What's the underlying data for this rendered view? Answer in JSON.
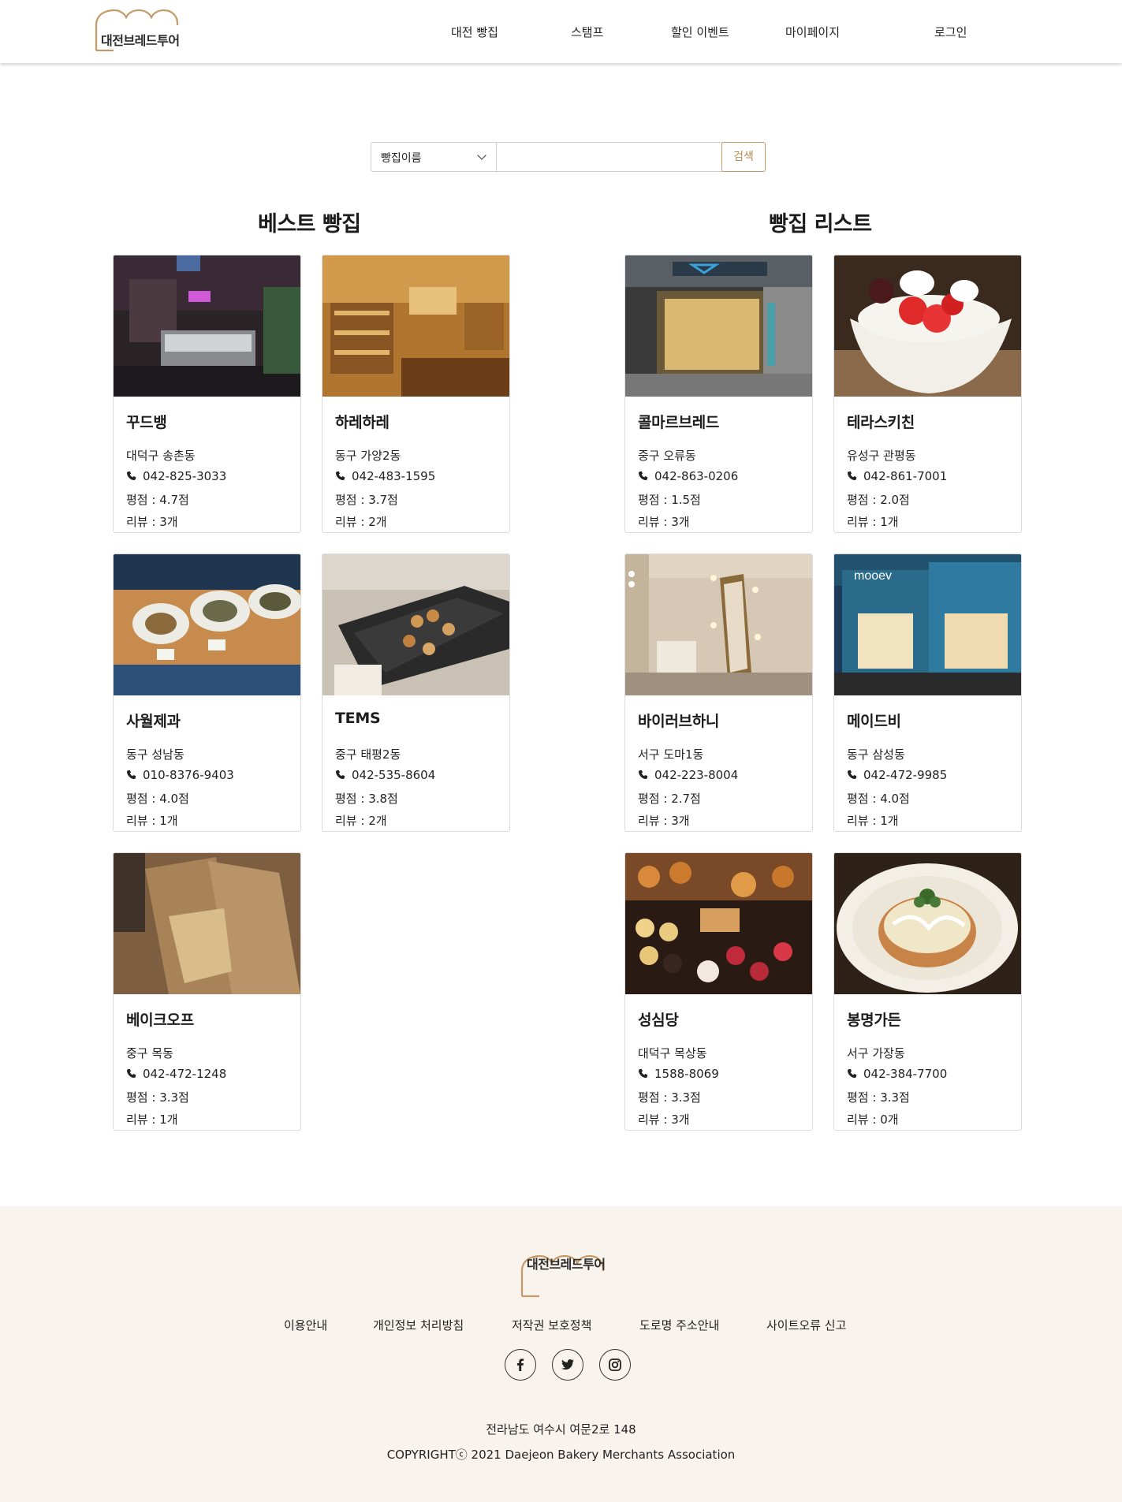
{
  "brand": {
    "name": "대전브레드투어"
  },
  "colors": {
    "accent": "#c79a65",
    "footer_bg": "#f8f4ed"
  },
  "nav": {
    "items": [
      "대전 빵집",
      "스탬프",
      "할인 이벤트",
      "마이페이지"
    ],
    "login": "로그인"
  },
  "search": {
    "select_value": "빵집이름",
    "input_value": "",
    "button": "검색"
  },
  "sections": {
    "best": "베스트 빵집",
    "list": "빵집 리스트"
  },
  "best_bakeries": [
    {
      "name": "꾸드뱅",
      "address": "대덕구 송촌동",
      "phone": "042-825-3033",
      "rating": "평점 : 4.7점",
      "reviews": "리뷰 : 3개",
      "photo": "cafe-interior-night"
    },
    {
      "name": "하레하레",
      "address": "동구 가양2동",
      "phone": "042-483-1595",
      "rating": "평점 : 3.7점",
      "reviews": "리뷰 : 2개",
      "photo": "wooden-shop-interior"
    },
    {
      "name": "사월제과",
      "address": "동구 성남동",
      "phone": "010-8376-9403",
      "rating": "평점 : 4.0점",
      "reviews": "리뷰 : 1개",
      "photo": "plates-on-table"
    },
    {
      "name": "TEMS",
      "address": "중구 태평2동",
      "phone": "042-535-8604",
      "rating": "평점 : 3.8점",
      "reviews": "리뷰 : 2개",
      "photo": "bread-trays"
    },
    {
      "name": "베이크오프",
      "address": "중구 목동",
      "phone": "042-472-1248",
      "rating": "평점 : 3.3점",
      "reviews": "리뷰 : 1개",
      "photo": "paper-bags"
    }
  ],
  "bakery_list": [
    {
      "name": "콜마르브레드",
      "address": "중구 오류동",
      "phone": "042-863-0206",
      "rating": "평점 : 1.5점",
      "reviews": "리뷰 : 3개",
      "photo": "storefront"
    },
    {
      "name": "테라스키친",
      "address": "유성구 관평동",
      "phone": "042-861-7001",
      "rating": "평점 : 2.0점",
      "reviews": "리뷰 : 1개",
      "photo": "strawberry-bingsu"
    },
    {
      "name": "바이러브하니",
      "address": "서구 도마1동",
      "phone": "042-223-8004",
      "rating": "평점 : 2.7점",
      "reviews": "리뷰 : 3개",
      "photo": "mirror-interior"
    },
    {
      "name": "메이드비",
      "address": "동구 삼성동",
      "phone": "042-472-9985",
      "rating": "평점 : 4.0점",
      "reviews": "리뷰 : 1개",
      "photo": "blue-storefront"
    },
    {
      "name": "성심당",
      "address": "대덕구 목상동",
      "phone": "1588-8069",
      "rating": "평점 : 3.3점",
      "reviews": "리뷰 : 3개",
      "photo": "pastry-display"
    },
    {
      "name": "봉명가든",
      "address": "서구 가장동",
      "phone": "042-384-7700",
      "rating": "평점 : 3.3점",
      "reviews": "리뷰 : 0개",
      "photo": "cream-bread-plate"
    }
  ],
  "footer": {
    "links": [
      "이용안내",
      "개인정보 처리방침",
      "저작권 보호정책",
      "도로명 주소안내",
      "사이트오류 신고"
    ],
    "social": [
      "facebook-icon",
      "twitter-icon",
      "instagram-icon"
    ],
    "address": "전라남도 여수시 여문2로 148",
    "copyright": "COPYRIGHTⓒ 2021 Daejeon Bakery Merchants Association"
  }
}
